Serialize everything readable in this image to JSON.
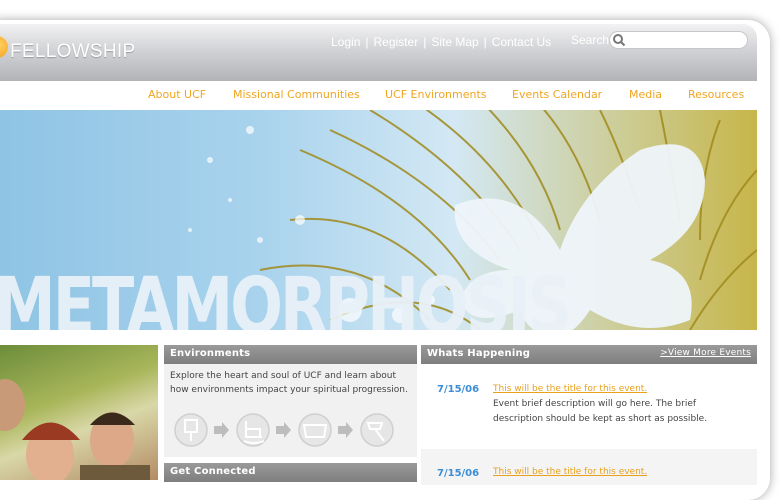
{
  "site": {
    "logo_text": "FELLOWSHIP"
  },
  "utility_links": [
    "Login",
    "Register",
    "Site Map",
    "Contact Us"
  ],
  "utility_separator": "|",
  "search": {
    "label": "Search",
    "placeholder": ""
  },
  "nav": [
    {
      "label": "About UCF"
    },
    {
      "label": "Missional Communities"
    },
    {
      "label": "UCF Environments"
    },
    {
      "label": "Events Calendar"
    },
    {
      "label": "Media"
    },
    {
      "label": "Resources"
    }
  ],
  "hero": {
    "title": "METAMORPHOSIS"
  },
  "environments": {
    "heading": "Environments",
    "text": "Explore the heart and soul of UCF and learn about how environments impact your spiritual progression.",
    "steps": [
      "lamp-icon",
      "rocking-chair-icon",
      "sofa-icon",
      "hammer-icon"
    ]
  },
  "get_connected": {
    "heading": "Get Connected"
  },
  "whats_happening": {
    "heading": "Whats Happening",
    "more_link": ">View More Events",
    "events": [
      {
        "date": "7/15/06",
        "title": "This will be the title for this event.",
        "description": "Event brief description will go here. The brief description should be kept as short as possible."
      },
      {
        "date": "7/15/06",
        "title": "This will be the title for this event.",
        "description": ""
      }
    ]
  },
  "colors": {
    "accent": "#f0a520",
    "date_blue": "#3b8ed6",
    "panel_header": "#8a8a8a"
  }
}
